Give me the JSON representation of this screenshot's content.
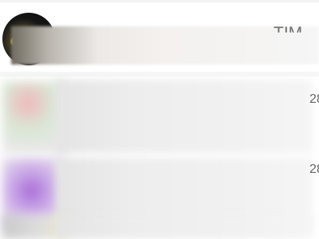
{
  "header": {
    "avatar_icon": "profile-avatar-icon",
    "text_fragment": "TIM"
  },
  "feed": {
    "items": [
      {
        "edge_text": "28"
      },
      {
        "edge_text": "28"
      },
      {
        "edge_text": ""
      }
    ]
  },
  "colors": {
    "background": "#ffffff",
    "divider": "#f7f7f7",
    "accent_purple": "#a86ad4"
  }
}
